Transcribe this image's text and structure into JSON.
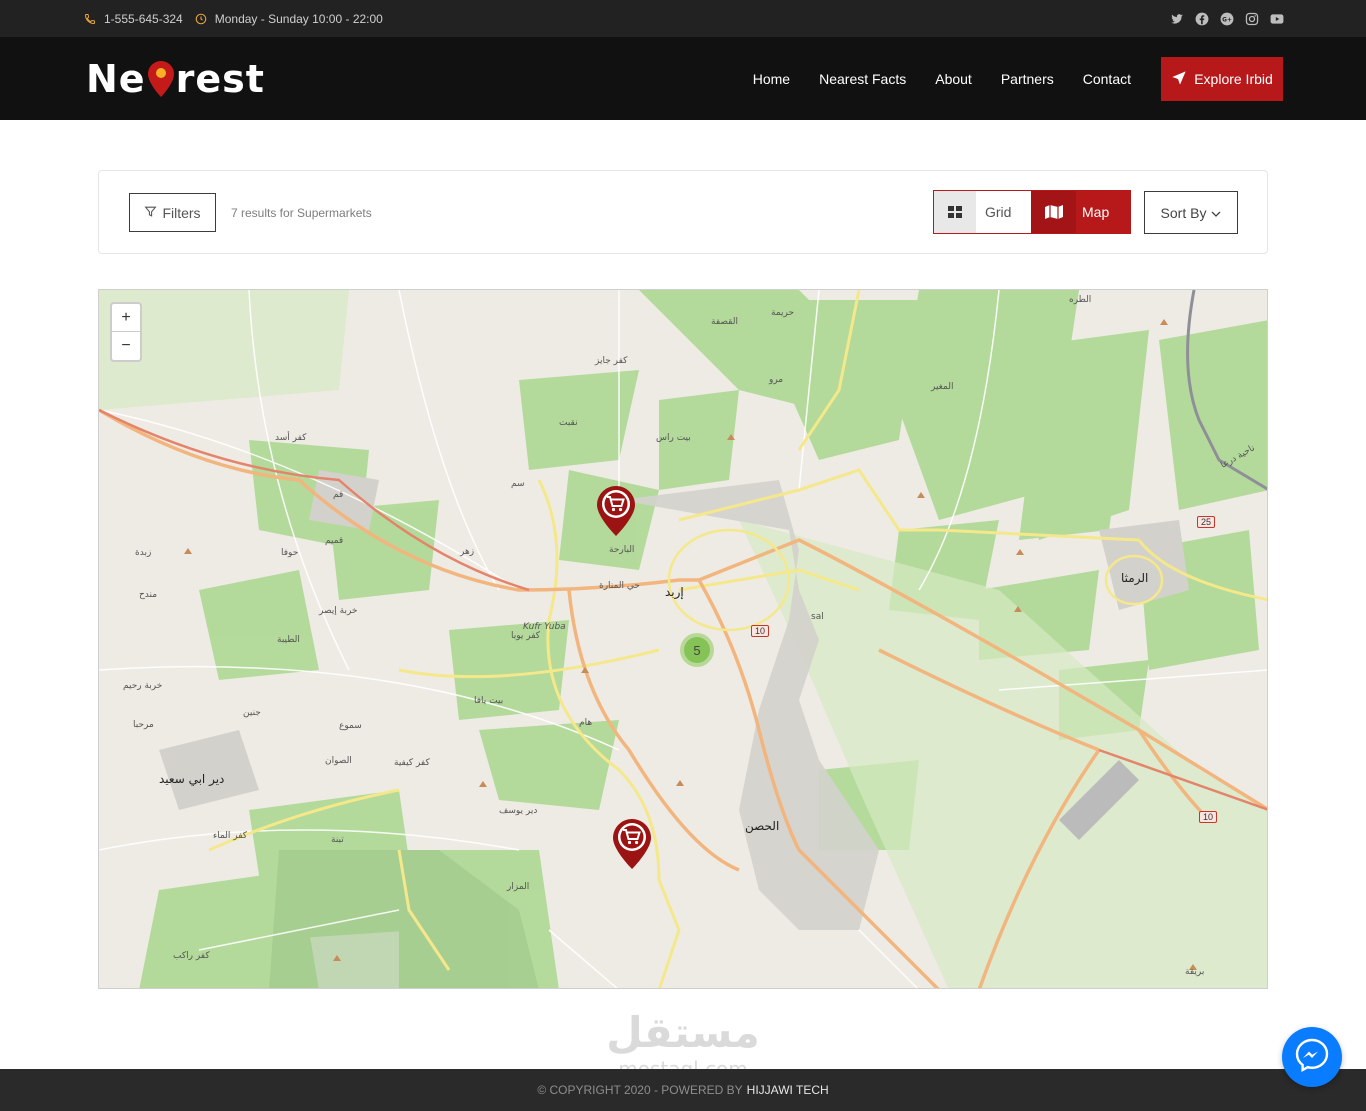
{
  "topbar": {
    "phone": "1-555-645-324",
    "hours": "Monday - Sunday 10:00 - 22:00",
    "social": [
      "twitter-icon",
      "facebook-icon",
      "google-plus-icon",
      "instagram-icon",
      "youtube-icon"
    ]
  },
  "brand": {
    "logo_start": "Ne",
    "logo_end": "rest"
  },
  "nav": {
    "items": [
      "Home",
      "Nearest Facts",
      "About",
      "Partners",
      "Contact"
    ],
    "cta": "Explore Irbid"
  },
  "listing": {
    "filters_label": "Filters",
    "results_text": "7 results for Supermarkets",
    "view_grid": "Grid",
    "view_map": "Map",
    "active_view": "Map",
    "sort_label": "Sort By"
  },
  "map": {
    "zoom_in": "+",
    "zoom_out": "−",
    "cluster_count": "5",
    "markers": [
      "supermarket-marker",
      "supermarket-marker"
    ],
    "labels": {
      "irbid": "إربد",
      "ramtha": "الرمثا",
      "husn": "الحصن",
      "deir_abi_said": "دير ابي سعيد",
      "torra": "الطره",
      "kufr_yuba": "Kufr Yuba",
      "kufr_yuba_ar": "كفر يوبا",
      "hay_manara": "حي المنارة",
      "barha": "البارحة",
      "sal": "sal",
      "bait_ras": "بيت راس",
      "kufr_asad": "كفر أسد",
      "mughayyir": "المغير",
      "hoffa": "حوفا",
      "qumaim": "قميم",
      "bait_yafa": "بيت يافا",
      "kufr_kifya": "كفر كيفية",
      "deir_yousef": "دير يوسف",
      "mazar": "المزار",
      "sam": "سم",
      "samu": "سموع",
      "kufr_jayez": "كفر جايز",
      "kufr_rakib": "كفر راكب",
      "kufr_elma": "كفر الماء",
      "hamm": "هام",
      "zahar": "زهر",
      "qasfa": "القصفة",
      "haraima": "حريمة",
      "marw": "مرو",
      "tayba": "الطيبة",
      "ebsar": "خربة إيصر",
      "rahim": "خربة رحيم",
      "jinin": "جنين",
      "sawan": "الصوان",
      "marhaba": "مرحبا",
      "tibna": "تبنة",
      "qum": "قم",
      "zabda": "زبدة",
      "mandah": "مندح",
      "bureiqa": "بريقة",
      "dara_area": "ناحية درعا",
      "taqbal": "نقبت"
    },
    "shields": [
      "10",
      "10",
      "25"
    ]
  },
  "footer": {
    "copyright": "© COPYRIGHT 2020 - POWERED BY",
    "company": "HIJJAWI TECH"
  },
  "watermark": {
    "arabic": "مستقل",
    "latin": "mostaql.com"
  },
  "colors": {
    "accent": "#b7191b",
    "topbar": "#222222",
    "navbar": "#111111",
    "footer": "#2a2a2a",
    "messenger": "#0a7cff"
  }
}
